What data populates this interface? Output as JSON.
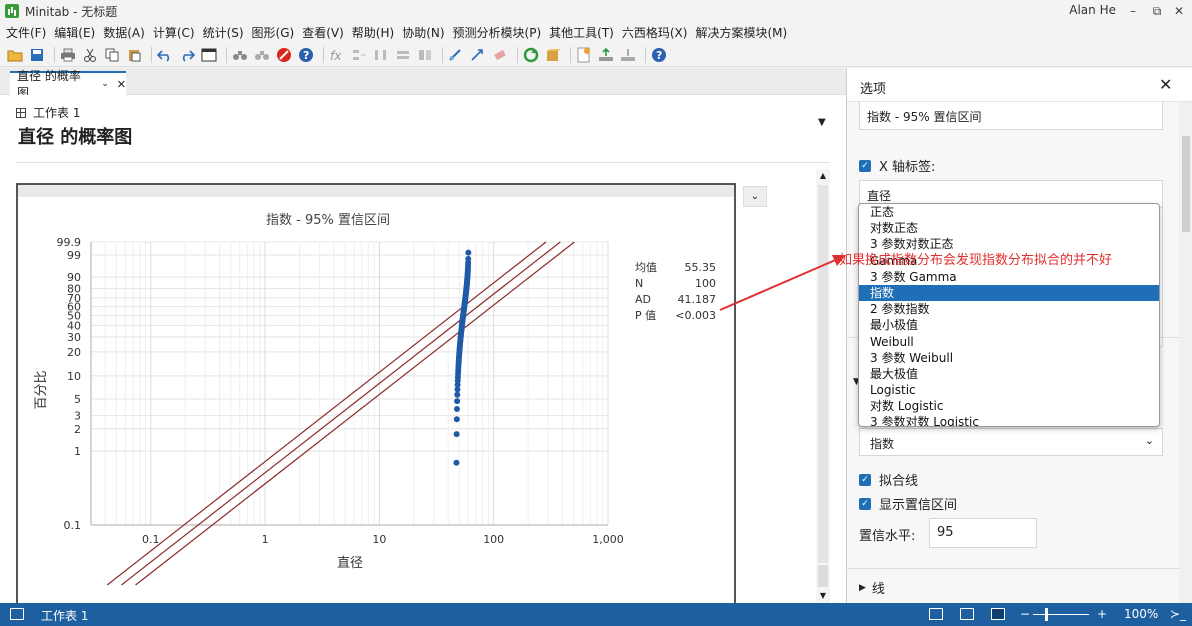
{
  "titlebar": {
    "app_title": "Minitab - 无标题",
    "user": "Alan He",
    "minimize": "–",
    "restore": "⧉",
    "close": "✕"
  },
  "menu": [
    "文件(F)",
    "编辑(E)",
    "数据(A)",
    "计算(C)",
    "统计(S)",
    "图形(G)",
    "查看(V)",
    "帮助(H)",
    "协助(N)",
    "预测分析模块(P)",
    "其他工具(T)",
    "六西格玛(X)",
    "解决方案模块(M)"
  ],
  "tab": {
    "label": "直径 的概率图",
    "chevron": "⌄",
    "close": "✕"
  },
  "main": {
    "worksheet": "工作表 1",
    "title": "直径 的概率图",
    "caret": "▼",
    "graph_menu": "⌄"
  },
  "chart_data": {
    "type": "scatter",
    "title": "指数 - 95% 置信区间",
    "xlabel": "直径",
    "ylabel": "百分比",
    "x_scale": "log",
    "y_scale": "exponential probability",
    "xlim": [
      0.03,
      1000
    ],
    "ylim": [
      0.1,
      99.9
    ],
    "x_ticks": [
      "0.1",
      "1",
      "10",
      "100",
      "1,000"
    ],
    "y_ticks": [
      "0.1",
      "1",
      "2",
      "3",
      "5",
      "10",
      "20",
      "30",
      "40",
      "50",
      "60",
      "70",
      "80",
      "90",
      "99",
      "99.9"
    ],
    "grid": true,
    "colors": {
      "points": "#1f5aa6",
      "fit_lines": "#8b2b2b"
    },
    "stats": [
      {
        "label": "均值",
        "value": "55.35"
      },
      {
        "label": "N",
        "value": "100"
      },
      {
        "label": "AD",
        "value": "41.187"
      },
      {
        "label": "P 值",
        "value": "<0.003"
      }
    ]
  },
  "panel": {
    "title": "选项",
    "close": "✕",
    "title_field": "指数 - 95% 置信区间",
    "x_axis_label_check": "X 轴标签:",
    "x_axis_label_value": "直径",
    "dropdown_options": [
      "正态",
      "对数正态",
      "3 参数对数正态",
      "Gamma",
      "3 参数 Gamma",
      "指数",
      "2 参数指数",
      "最小极值",
      "Weibull",
      "3 参数 Weibull",
      "最大极值",
      "Logistic",
      "对数 Logistic",
      "3 参数对数 Logistic"
    ],
    "selected_option": "指数",
    "distribution_select": "指数",
    "fit_line_check": "拟合线",
    "ci_check": "显示置信区间",
    "conf_level_label": "置信水平:",
    "conf_level_value": "95",
    "line_section": "线"
  },
  "annotation": "如果换成指数分布会发现指数分布拟合的并不好",
  "statusbar": {
    "worksheet": "工作表 1",
    "zoom": "100%",
    "minus": "−",
    "plus": "+"
  }
}
